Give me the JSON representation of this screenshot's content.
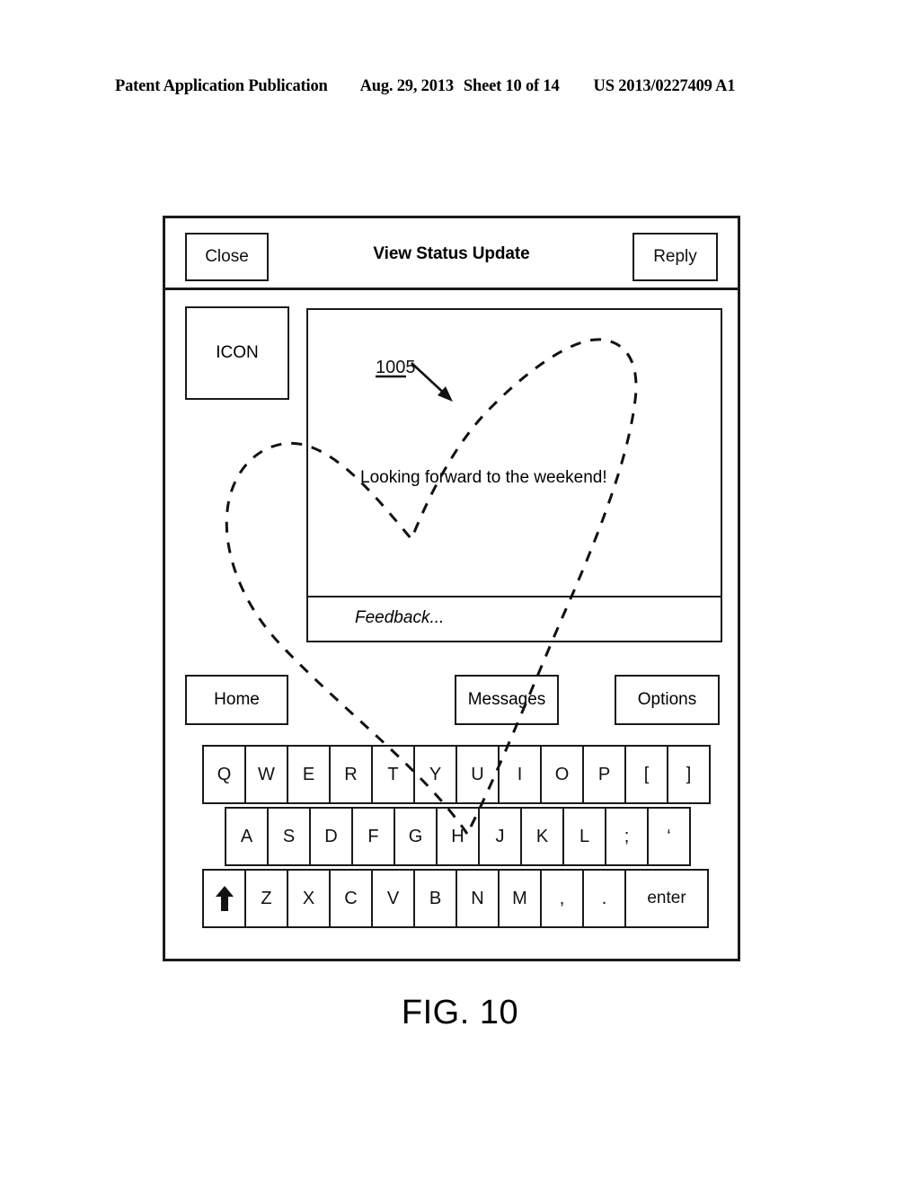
{
  "patent_header": {
    "publication": "Patent Application Publication",
    "date": "Aug. 29, 2013",
    "sheet": "Sheet 10 of 14",
    "number": "US 2013/0227409 A1"
  },
  "figure": {
    "caption": "FIG. 10",
    "reference_numeral": "1005",
    "reference_target": "dashed heart gesture drawn over message view"
  },
  "device": {
    "titlebar": {
      "close_label": "Close",
      "title": "View Status Update",
      "reply_label": "Reply"
    },
    "icon_box": {
      "label": "ICON"
    },
    "content": {
      "status_text": "Looking forward to the weekend!",
      "feedback_placeholder": "Feedback..."
    },
    "toolbar": {
      "home_label": "Home",
      "messages_label": "Messages",
      "options_label": "Options"
    },
    "keyboard": {
      "row0": [
        "Q",
        "W",
        "E",
        "R",
        "T",
        "Y",
        "U",
        "I",
        "O",
        "P",
        "[",
        "]"
      ],
      "row1": [
        "A",
        "S",
        "D",
        "F",
        "G",
        "H",
        "J",
        "K",
        "L",
        ";",
        "‘"
      ],
      "row2": [
        "Z",
        "X",
        "C",
        "V",
        "B",
        "N",
        "M",
        ",",
        "."
      ],
      "shift_icon": "up-arrow-icon",
      "enter_label": "enter"
    }
  },
  "colors": {
    "ink": "#1a1a1a",
    "page": "#ffffff"
  }
}
